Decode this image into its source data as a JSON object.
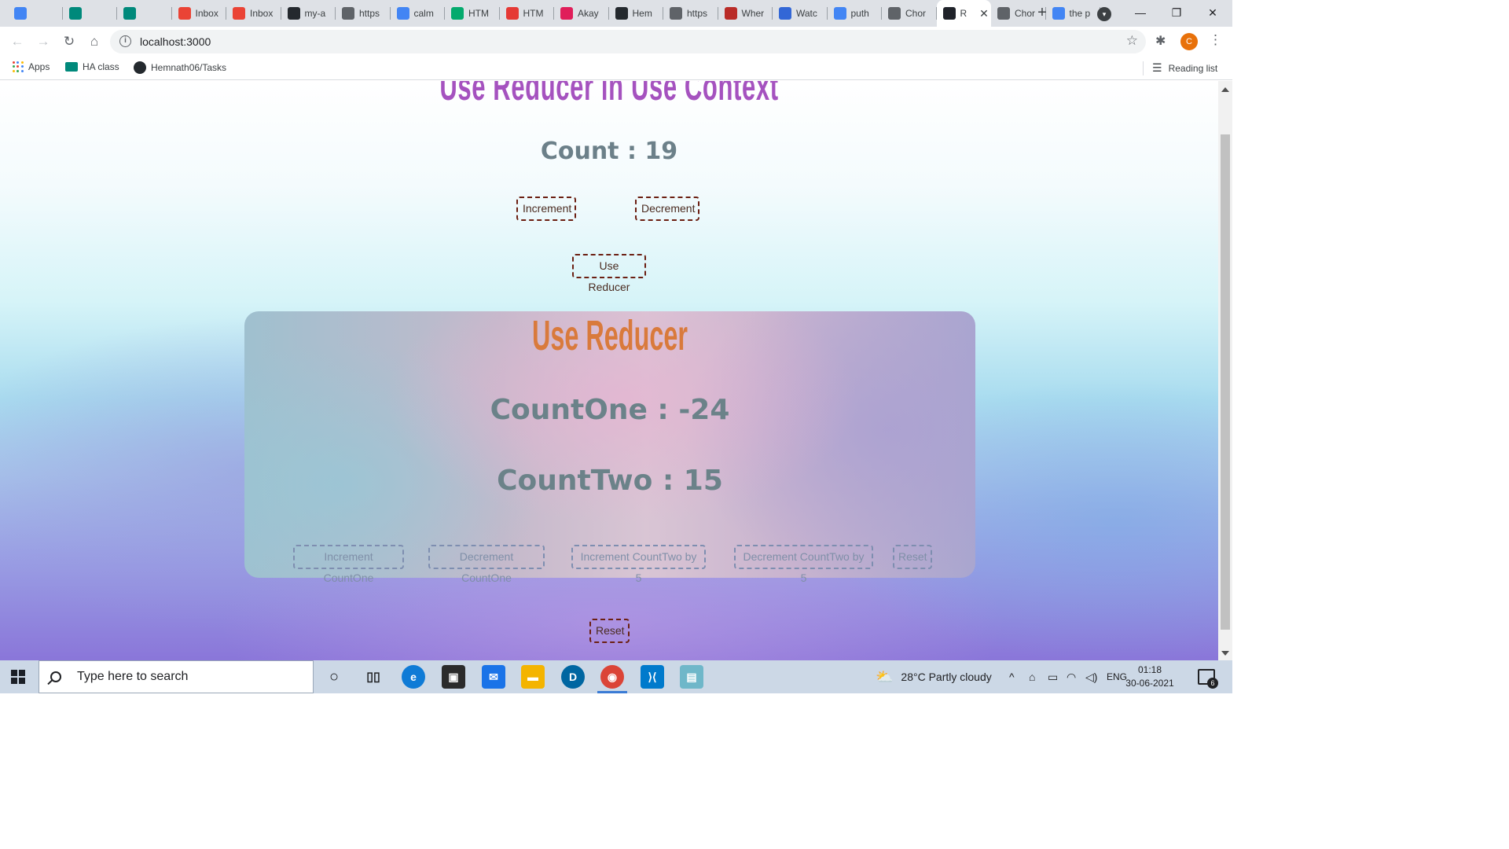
{
  "browser": {
    "tabs": [
      {
        "label": "",
        "icon": "extension-icon",
        "color": "#4285f4"
      },
      {
        "label": "",
        "icon": "meet-icon",
        "color": "#00897b"
      },
      {
        "label": "",
        "icon": "meet-icon",
        "color": "#00897b"
      },
      {
        "label": "Inbox",
        "icon": "gmail-icon",
        "color": "#ea4335"
      },
      {
        "label": "Inbox",
        "icon": "gmail-icon",
        "color": "#ea4335"
      },
      {
        "label": "my-a",
        "icon": "github-icon",
        "color": "#24292e"
      },
      {
        "label": "https",
        "icon": "page-icon",
        "color": "#5f6368"
      },
      {
        "label": "calm",
        "icon": "google-icon",
        "color": "#4285f4"
      },
      {
        "label": "HTM",
        "icon": "w3schools-icon",
        "color": "#04aa6d"
      },
      {
        "label": "HTM",
        "icon": "opera-icon",
        "color": "#e53935"
      },
      {
        "label": "Akay",
        "icon": "slack-icon",
        "color": "#e01e5a"
      },
      {
        "label": "Hem",
        "icon": "github-icon",
        "color": "#24292e"
      },
      {
        "label": "https",
        "icon": "globe-icon",
        "color": "#5f6368"
      },
      {
        "label": "Wher",
        "icon": "quora-icon",
        "color": "#b92b27"
      },
      {
        "label": "Watc",
        "icon": "play-icon",
        "color": "#3367d6"
      },
      {
        "label": "puth",
        "icon": "google-icon",
        "color": "#4285f4"
      },
      {
        "label": "Chor",
        "icon": "globe-icon",
        "color": "#5f6368"
      },
      {
        "label": "R",
        "icon": "react-icon",
        "color": "#20232a",
        "active": true
      },
      {
        "label": "Chor",
        "icon": "globe-icon",
        "color": "#5f6368"
      },
      {
        "label": "the p",
        "icon": "google-icon",
        "color": "#4285f4"
      }
    ],
    "url": "localhost:3000",
    "profile_initial": "C",
    "bookmarks": [
      {
        "label": "Apps"
      },
      {
        "label": "HA class"
      },
      {
        "label": "Hemnath06/Tasks"
      }
    ],
    "reading_list": "Reading list"
  },
  "page": {
    "context_title": "Use Reducer in Use Context",
    "count_label": "Count : 19",
    "increment_label": "Increment",
    "decrement_label": "Decrement",
    "use_reducer_label": "Use Reducer",
    "reducer": {
      "title": "Use Reducer",
      "count_one_label": "CountOne : -24",
      "count_two_label": "CountTwo : 15",
      "buttons": [
        "Increment CountOne",
        "Decrement CountOne",
        "Increment CountTwo by 5",
        "Decrement CountTwo by 5",
        "Reset"
      ]
    },
    "reset_label": "Reset"
  },
  "taskbar": {
    "search_placeholder": "Type here to search",
    "weather": "28°C  Partly cloudy",
    "language": "ENG",
    "time": "01:18",
    "date": "30-06-2021",
    "notifications": "6"
  }
}
